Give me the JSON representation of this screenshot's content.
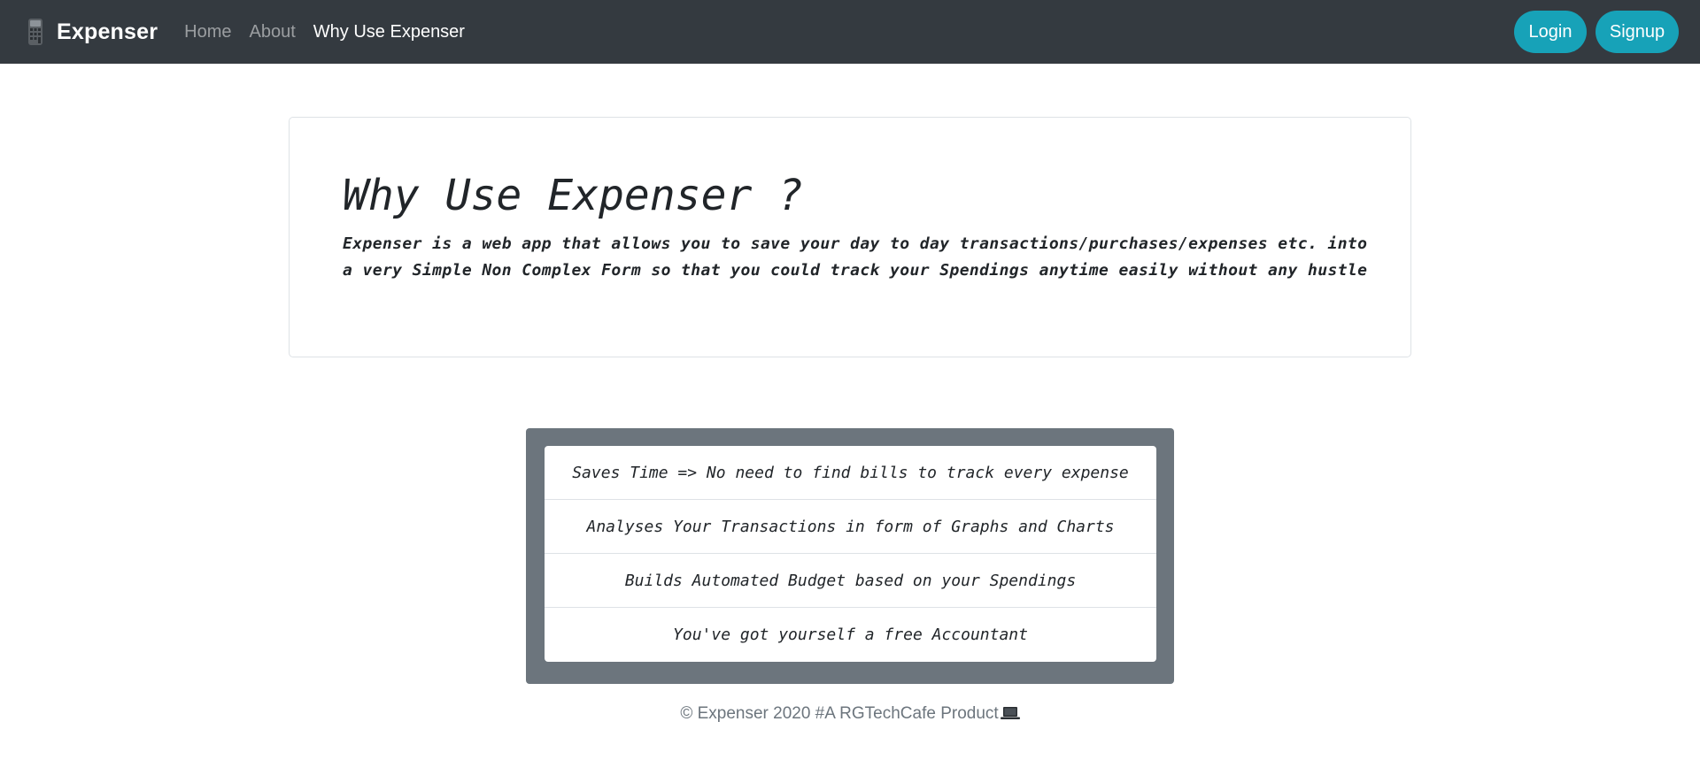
{
  "navbar": {
    "brand": "Expenser",
    "links": [
      {
        "label": "Home",
        "active": false
      },
      {
        "label": "About",
        "active": false
      },
      {
        "label": "Why Use Expenser",
        "active": true
      }
    ],
    "login_label": "Login",
    "signup_label": "Signup",
    "background_color": "#343a40",
    "button_color": "#17a2b8"
  },
  "jumbotron": {
    "title": "Why Use Expenser ?",
    "text_line1": "Expenser is a web app that allows you to save your day to day transactions/purchases/expenses etc. into",
    "text_line2": "a very Simple Non Complex Form so that you could track your Spendings anytime easily without any hustle"
  },
  "features": {
    "background_color": "#6c757d",
    "items": [
      {
        "label": "Saves Time => No need to find bills to track every expense"
      },
      {
        "label": "Analyses Your Transactions in form of Graphs and Charts"
      },
      {
        "label": "Builds Automated Budget based on your Spendings"
      },
      {
        "label": "You've got yourself a free Accountant"
      }
    ]
  },
  "footer": {
    "text": "© Expenser 2020 #A RGTechCafe Product",
    "icon": "laptop-icon"
  },
  "icons": {
    "brand_icon": "calculator-icon"
  }
}
